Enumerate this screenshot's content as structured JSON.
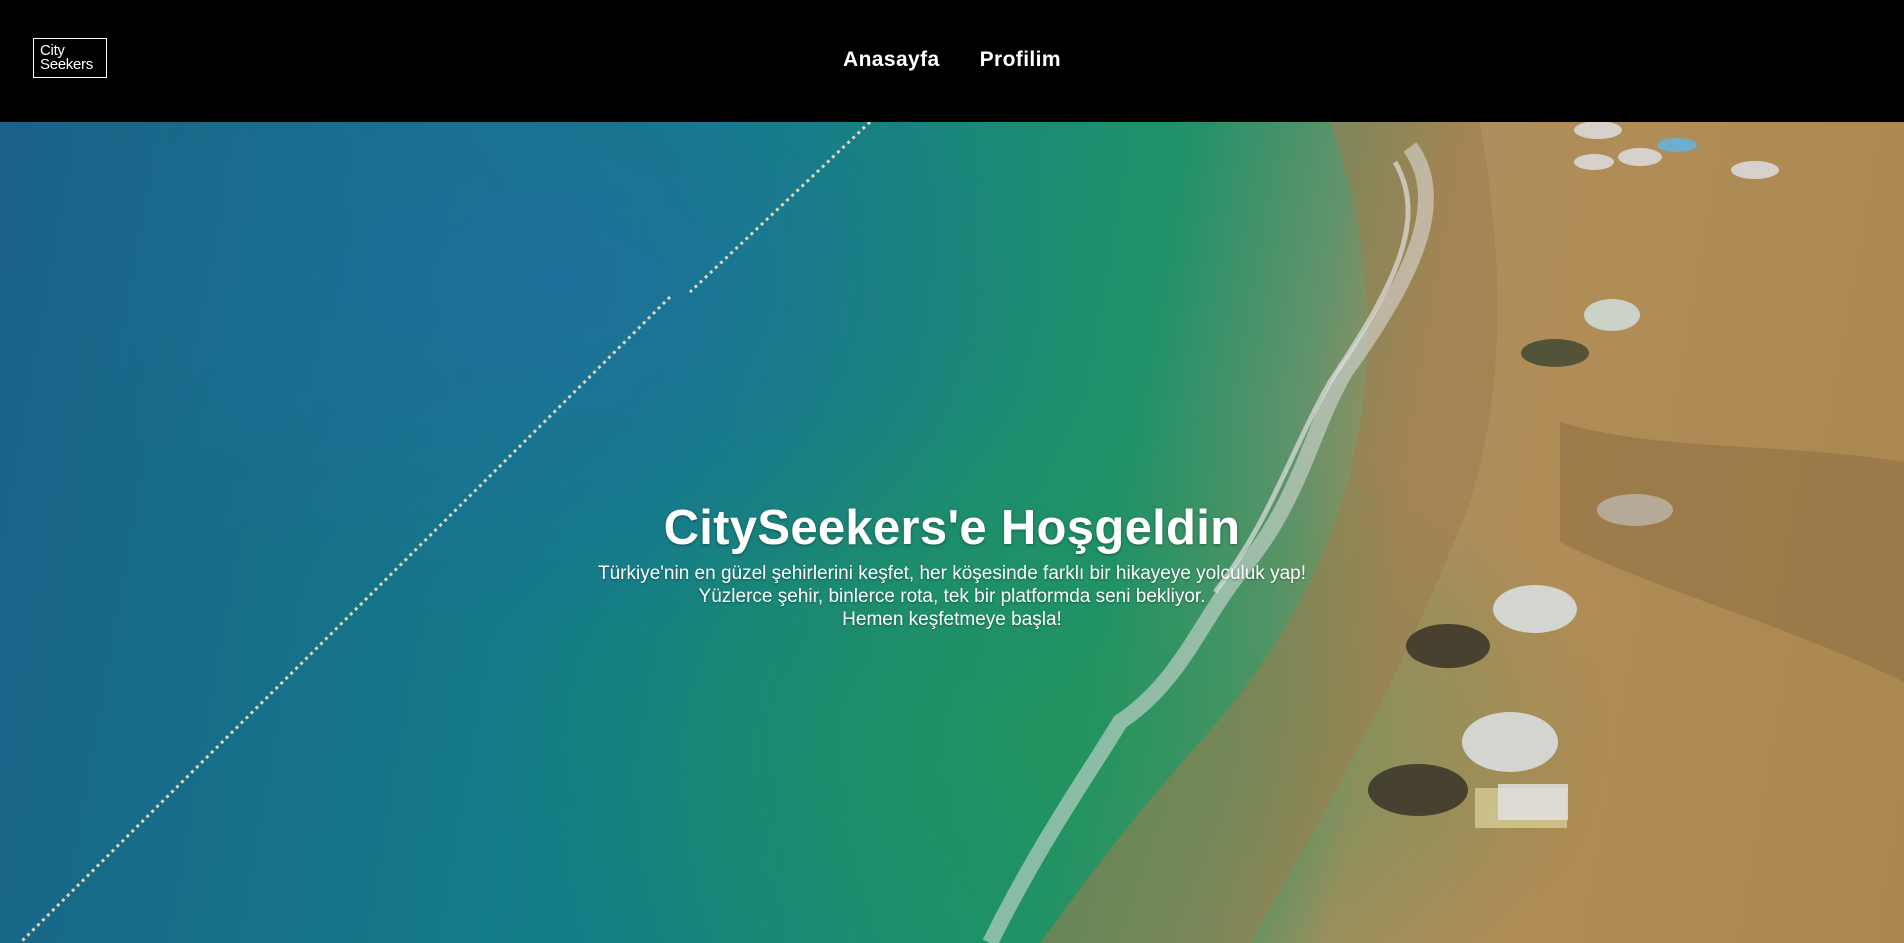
{
  "logo": {
    "line1": "City",
    "line2": "Seekers"
  },
  "nav": {
    "items": [
      {
        "label": "Anasayfa"
      },
      {
        "label": "Profilim"
      }
    ]
  },
  "hero": {
    "background_image": "beach-aerial-photo",
    "title": "CitySeekers'e Hoşgeldin",
    "subtitle_lines": [
      "Türkiye'nin en güzel şehirlerini keşfet, her köşesinde farklı bir hikayeye yolculuk yap!",
      "Yüzlerce şehir, binlerce rota, tek bir platformda seni bekliyor.",
      "Hemen keşfetmeye başla!"
    ]
  },
  "colors": {
    "navbar": "#000000",
    "text": "#ffffff",
    "sea": "#1a8fa0",
    "sand": "#c9a062"
  }
}
